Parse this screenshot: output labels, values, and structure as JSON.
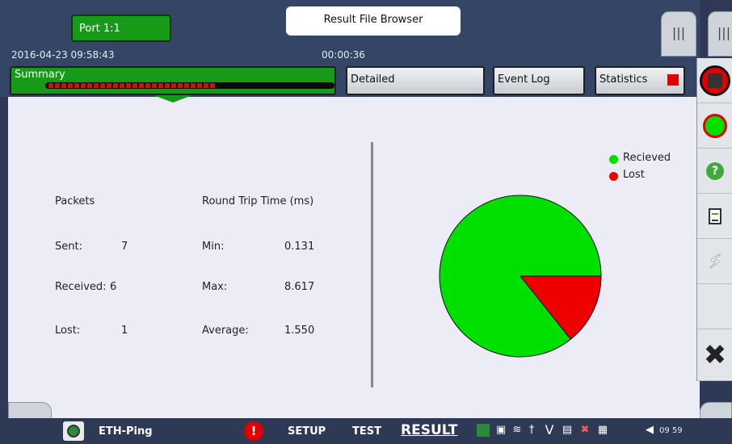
{
  "header": {
    "port_label": "Port 1:1",
    "file_browser_label": "Result File Browser",
    "datetime": "2016-04-23 09:58:43",
    "elapsed": "00:00:36",
    "panel_tab_icon": "|||"
  },
  "tabs": {
    "summary": "Summary",
    "detailed": "Detailed",
    "event_log": "Event Log",
    "statistics": "Statistics"
  },
  "packets": {
    "heading": "Packets",
    "sent_label": "Sent:",
    "sent_value": "7",
    "received_label": "Received:",
    "received_value": "6",
    "lost_label": "Lost:",
    "lost_value": "1"
  },
  "rtt": {
    "heading": "Round Trip Time (ms)",
    "min_label": "Min:",
    "min_value": "0.131",
    "max_label": "Max:",
    "max_value": "8.617",
    "avg_label": "Average:",
    "avg_value": "1.550"
  },
  "chart_data": {
    "type": "pie",
    "labels": [
      "Recieved",
      "Lost"
    ],
    "values": [
      6,
      1
    ],
    "colors": [
      "#00e000",
      "#ee0000"
    ],
    "legend_position": "top-right"
  },
  "sidebar": {
    "icons": [
      "stop-icon",
      "start-icon",
      "help-icon",
      "report-icon",
      "lightning-icon",
      "close-icon"
    ],
    "help_glyph": "?"
  },
  "bottom": {
    "left_tab": "(((",
    "right_tab": ")))",
    "test_name": "ETH-Ping",
    "alarm_glyph": "!",
    "setup": "SETUP",
    "test": "TEST",
    "result": "RESULT",
    "clock": "09 59"
  },
  "colors": {
    "accent_green": "#179a17",
    "alarm_red": "#e00000",
    "header_bg": "#354566"
  }
}
